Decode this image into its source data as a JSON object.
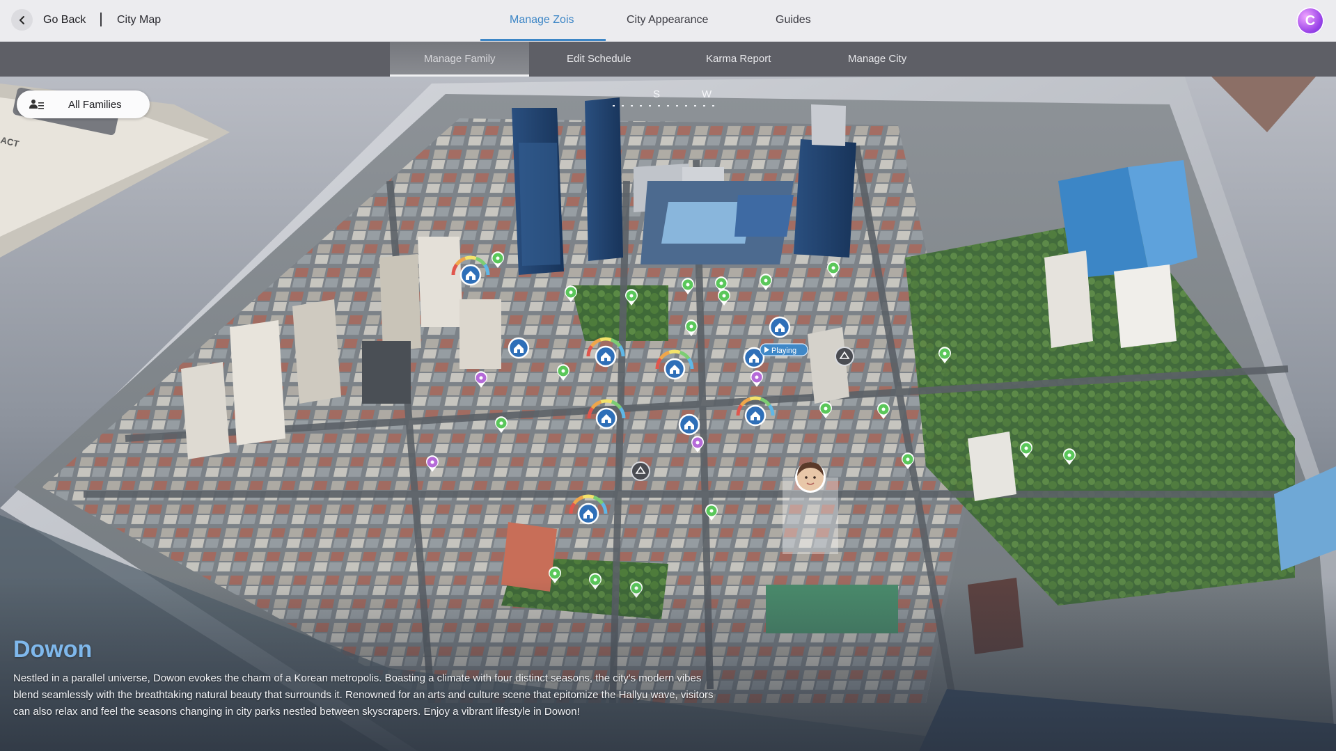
{
  "topbar": {
    "back_label": "Go Back",
    "breadcrumb": "City Map",
    "tabs": [
      {
        "label": "Manage Zois",
        "active": true
      },
      {
        "label": "City Appearance",
        "active": false
      },
      {
        "label": "Guides",
        "active": false
      }
    ],
    "avatar_icon": "currency-c-icon",
    "accent_color": "#3d86c6"
  },
  "subnav": {
    "tabs": [
      {
        "label": "Manage Family",
        "active": true
      },
      {
        "label": "Edit Schedule",
        "active": false
      },
      {
        "label": "Karma Report",
        "active": false
      },
      {
        "label": "Manage City",
        "active": false
      }
    ]
  },
  "filter": {
    "label": "All Families",
    "icon": "family-icon"
  },
  "map": {
    "compass": {
      "s": "S",
      "w": "W"
    },
    "playing_label": "Playing",
    "marker_types": [
      "house-marker-icon",
      "location-pin-icon",
      "speech-pin-icon",
      "event-marker-icon",
      "zoi-portrait-icon"
    ]
  },
  "city": {
    "name": "Dowon",
    "description": "Nestled in a parallel universe, Dowon evokes the charm of a Korean metropolis. Boasting a climate with four distinct seasons, the city's modern vibes blend seamlessly with the breathtaking natural beauty that surrounds it. Renowned for an arts and culture scene that epitomize the Hallyu wave, visitors can also relax and feel the seasons changing in city parks nestled between skyscrapers. Enjoy a vibrant lifestyle in Dowon!",
    "title_color": "#7fb8ec"
  }
}
